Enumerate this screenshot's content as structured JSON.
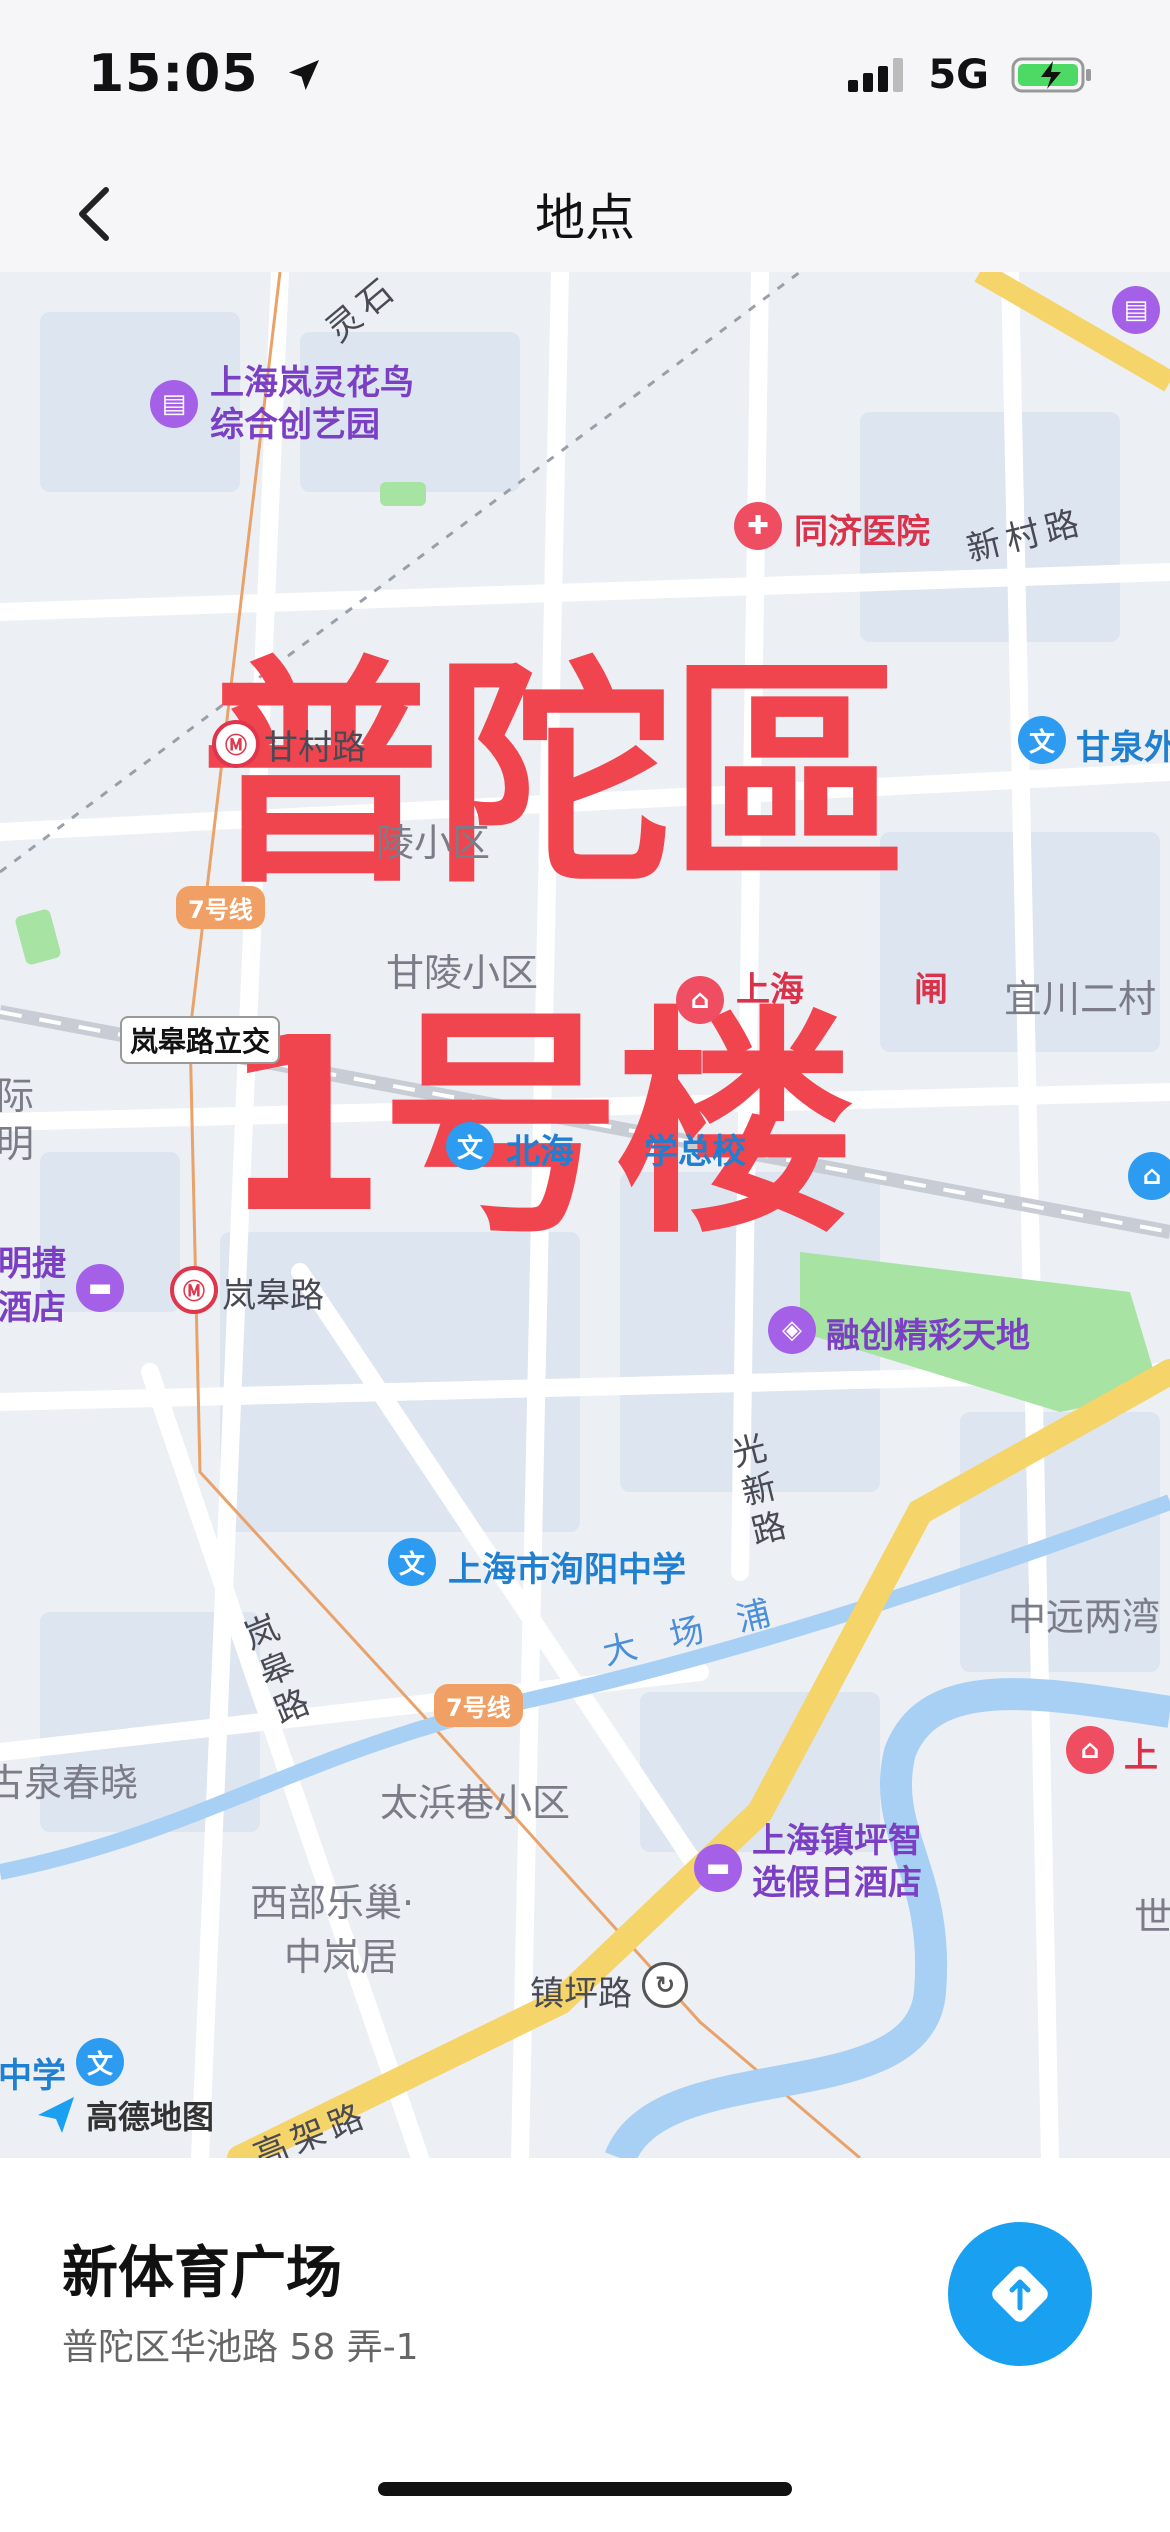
{
  "status_bar": {
    "time": "15:05",
    "network": "5G"
  },
  "header": {
    "title": "地点"
  },
  "map": {
    "overlay_line1": "普陀區",
    "overlay_line2": "1号楼",
    "pois": {
      "lanling": [
        "上海岚灵花鸟",
        "综合创艺园"
      ],
      "tongji": "同济医院",
      "ganquan_school": "甘泉外",
      "beihai_school": "北海",
      "beihai_school_2": "学总校",
      "mingjie_hotel": [
        "明捷",
        "酒店"
      ],
      "rongchuang": "融创精彩天地",
      "xunyang": "上海市洵阳中学",
      "zhenping_hotel": [
        "上海镇坪智",
        "选假日酒店"
      ],
      "shanghai_far_right": "上",
      "middle_school_left": "中学",
      "shanghai_zhaja": [
        "上海",
        "闸"
      ]
    },
    "areas": {
      "ganling": "陵小区",
      "ganling2": "甘陵小区",
      "yichuan": "宜川二村",
      "zhongyuan": "中远两湾",
      "taibin": "太浜巷小区",
      "xibu": [
        "西部乐巢·",
        "中岚居"
      ],
      "quanchun": "古泉春晓",
      "shi": "世",
      "edge_left": [
        "际",
        "明"
      ]
    },
    "roads": {
      "xincun": "新村路",
      "guangxin": "光新路",
      "langao_vertical": "岚皋路",
      "linglong": "灵石",
      "elevated": "高架路"
    },
    "stations": {
      "langao": "岚皋路",
      "langao_xiwen": "岚皋路立交",
      "zhenping": "镇坪路",
      "north_station": "甘村路"
    },
    "river": "大 场 浦",
    "line7": "7号线",
    "logo": "高德地图"
  },
  "place": {
    "name": "新体育广场",
    "address": "普陀区华池路 58 弄-1"
  },
  "colors": {
    "accent": "#1aa0f0",
    "overlay": "#f0454f"
  }
}
